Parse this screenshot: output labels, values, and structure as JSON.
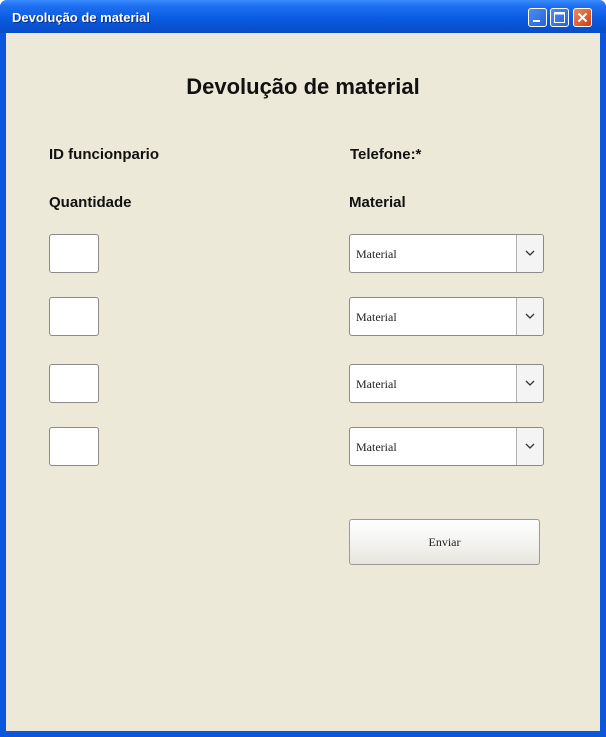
{
  "window": {
    "title": "Devolução de material"
  },
  "form": {
    "heading": "Devolução de material",
    "id_label": "ID funcionpario",
    "phone_label": "Telefone:*",
    "quantity_label": "Quantidade",
    "material_label": "Material",
    "quantities": [
      "",
      "",
      "",
      ""
    ],
    "materials": [
      "Material",
      "Material",
      "Material",
      "Material"
    ],
    "submit_label": "Enviar"
  },
  "icons": {
    "minimize": "minimize-icon",
    "maximize": "maximize-icon",
    "close": "close-icon",
    "dropdown": "chevron-down-icon"
  },
  "colors": {
    "titlebar": "#0a5ce3",
    "window_bg": "#ece9d8",
    "close_button": "#d23b12"
  }
}
